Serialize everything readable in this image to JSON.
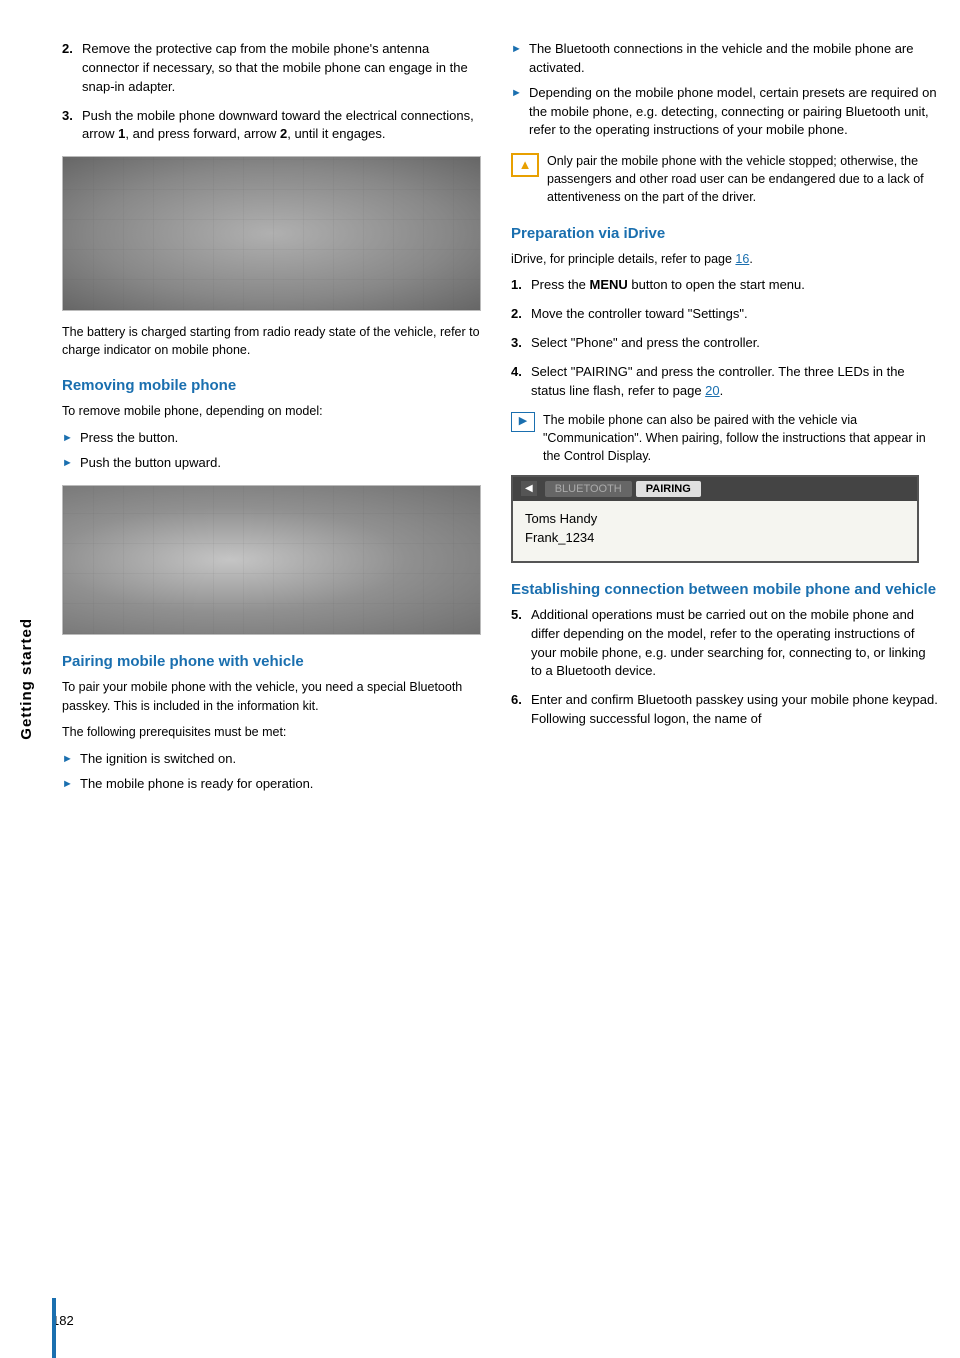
{
  "sidebar": {
    "label": "Getting started"
  },
  "page": {
    "number": "182"
  },
  "left_col": {
    "step2": {
      "num": "2.",
      "text": "Remove the protective cap from the mobile phone's antenna connector if necessary, so that the mobile phone can engage in the snap-in adapter."
    },
    "step3": {
      "num": "3.",
      "text": "Push the mobile phone downward toward the electrical connections, arrow ",
      "bold1": "1",
      "text2": ", and press forward, arrow ",
      "bold2": "2",
      "text3": ", until it engages."
    },
    "caption": "The battery is charged starting from radio ready state of the vehicle, refer to charge indicator on mobile phone.",
    "section1": {
      "heading": "Removing mobile phone",
      "intro": "To remove mobile phone, depending on model:",
      "bullet1": "Press the button.",
      "bullet2": "Push the button upward."
    },
    "section2": {
      "heading": "Pairing mobile phone with vehicle",
      "intro": "To pair your mobile phone with the vehicle, you need a special Bluetooth passkey. This is included in the information kit.",
      "prereq_intro": "The following prerequisites must be met:",
      "prereq1": "The ignition is switched on.",
      "prereq2": "The mobile phone is ready for operation."
    }
  },
  "right_col": {
    "bullet1": "The Bluetooth connections in the vehicle and the mobile phone are activated.",
    "bullet2": "Depending on the mobile phone model, certain presets are required on the mobile phone, e.g. detecting, connecting or pairing Bluetooth unit, refer to the operating instructions of your mobile phone.",
    "warning": {
      "text": "Only pair the mobile phone with the vehicle stopped; otherwise, the passengers and other road user can be endangered due to a lack of attentiveness on the part of the driver."
    },
    "section_idrive": {
      "heading": "Preparation via iDrive",
      "intro_text": "iDrive, for principle details, refer to page ",
      "intro_link": "16",
      "intro_end": ".",
      "step1": {
        "num": "1.",
        "text": "Press the ",
        "bold": "MENU",
        "text2": " button to open the start menu."
      },
      "step2": {
        "num": "2.",
        "text": "Move the controller toward \"Settings\"."
      },
      "step3": {
        "num": "3.",
        "text": "Select \"Phone\" and press the controller."
      },
      "step4": {
        "num": "4.",
        "text": "Select \"PAIRING\" and press the controller. The three LEDs in the status line flash, refer to page ",
        "link": "20",
        "text2": "."
      },
      "note": "The mobile phone can also be paired with the vehicle via \"Communication\". When pairing, follow the instructions that appear in the Control Display."
    },
    "bluetooth_display": {
      "tab_inactive": "BLUETOOTH",
      "tab_active": "PAIRING",
      "item1": "Toms Handy",
      "item2": "Frank_1234"
    },
    "section_connection": {
      "heading": "Establishing connection between mobile phone and vehicle",
      "step5": {
        "num": "5.",
        "text": "Additional operations must be carried out on the mobile phone and differ depending on the model, refer to the operating instructions of your mobile phone, e.g. under searching for, connecting to, or linking to a Bluetooth device."
      },
      "step6": {
        "num": "6.",
        "text": "Enter and confirm Bluetooth passkey using your mobile phone keypad. Following successful logon, the name of"
      }
    }
  }
}
